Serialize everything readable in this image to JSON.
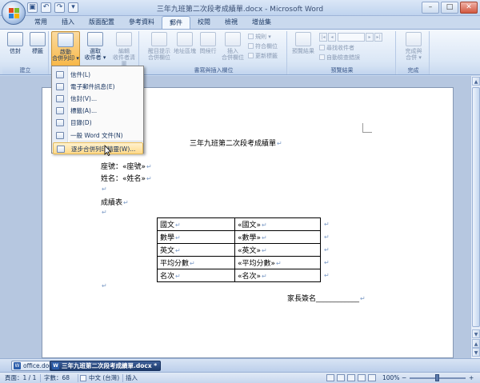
{
  "window": {
    "title": "三年九班第二次段考成績單.docx - Microsoft Word",
    "minimize": "–",
    "maximize": "□",
    "close": "✕"
  },
  "qat": {
    "save": "▣",
    "undo": "↶",
    "redo": "↷",
    "more": "▾"
  },
  "tabs": [
    "常用",
    "插入",
    "版面配置",
    "參考資料",
    "郵件",
    "校閱",
    "檢視",
    "增益集"
  ],
  "active_tab": "郵件",
  "ribbon": {
    "groups": {
      "create": "建立",
      "start": "",
      "write_insert": "書寫與插入欄位",
      "preview": "預覽結果",
      "finish": "完成"
    },
    "buttons": {
      "envelopes": "信封",
      "labels": "標籤",
      "start_line1": "啟動",
      "start_line2": "合併列印",
      "select_line1": "選取",
      "select_line2": "收件者",
      "edit_line1": "編輯",
      "edit_line2": "收件者清單",
      "highlight_line1": "醒目提示",
      "highlight_line2": "合併欄位",
      "address_block": "地址區塊",
      "greeting_line": "問候行",
      "insert_line1": "插入",
      "insert_line2": "合併欄位",
      "rules": "規則",
      "match_fields": "符合欄位",
      "update_labels": "更新標籤",
      "preview_results": "預覽結果",
      "find_recipient": "尋找收件者",
      "auto_check": "自動檢查錯誤",
      "finish_line1": "完成與",
      "finish_line2": "合併"
    }
  },
  "menu": {
    "items": [
      {
        "label": "信件(L)"
      },
      {
        "label": "電子郵件訊息(E)"
      },
      {
        "label": "信封(V)..."
      },
      {
        "label": "標籤(A)..."
      },
      {
        "label": "目錄(D)"
      },
      {
        "label": "一般 Word 文件(N)"
      },
      {
        "label": "逐步合併列印精靈(W)..."
      }
    ],
    "highlighted": "逐步合併列印精靈(W)..."
  },
  "document": {
    "heading": "三年九班第二次段考成績單",
    "seat_line": "座號：«座號»",
    "name_line": "姓名：«姓名»",
    "score_title": "成績表",
    "para_mark": "↵",
    "table": [
      [
        "國文",
        "«國文»"
      ],
      [
        "數學",
        "«數學»"
      ],
      [
        "英文",
        "«英文»"
      ],
      [
        "平均分數",
        "«平均分數»"
      ],
      [
        "名次",
        "«名次»"
      ]
    ],
    "signature": "家長簽名____________"
  },
  "doc_tabs": [
    {
      "label": "office.doc..."
    },
    {
      "label": "三年九班第二次段考成績單.docx *"
    }
  ],
  "status": {
    "page": "頁面：1 / 1",
    "words": "字數：68",
    "language": "中文 (台灣)",
    "mode": "插入",
    "zoom": "100%",
    "zoom_minus": "−",
    "zoom_plus": "+",
    "zoom_level": 0.5
  }
}
